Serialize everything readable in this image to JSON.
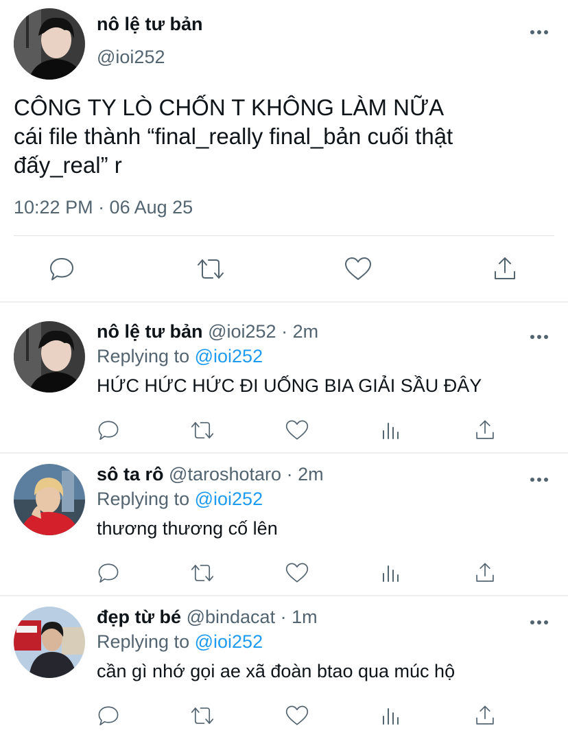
{
  "main_tweet": {
    "name": "nô lệ tư bản",
    "handle": "@ioi252",
    "text_lines": [
      "CÔNG TY LÒ CHỐN T KHÔNG LÀM NỮA",
      "cái file thành “final_really final_bản cuối thật",
      "đấy_real” r"
    ],
    "timestamp": "10:22 PM · 06 Aug 25",
    "actions": [
      "reply-icon",
      "retweet-icon",
      "like-icon",
      "share-icon"
    ]
  },
  "replies": [
    {
      "name": "nô lệ tư bản",
      "handle": "@ioi252",
      "separator": "·",
      "time": "2m",
      "replying_prefix": "Replying to",
      "replying_to": "@ioi252",
      "text": "HỨC HỨC HỨC ĐI UỐNG BIA GIẢI SẦU ĐÂY",
      "avatar_colors": {
        "bg": "#3a3a3a",
        "hair": "#111111",
        "skin": "#e9d2c4",
        "shirt": "#0c0c0c"
      }
    },
    {
      "name": "sô ta rô",
      "handle": "@taroshotaro",
      "separator": "·",
      "time": "2m",
      "replying_prefix": "Replying to",
      "replying_to": "@ioi252",
      "text": "thương thương cố lên",
      "avatar_colors": {
        "bg": "#5c7fa0",
        "hair": "#e8c98a",
        "skin": "#e8c7a8",
        "shirt": "#d4202a"
      }
    },
    {
      "name": "đẹp từ bé",
      "handle": "@bindacat",
      "separator": "·",
      "time": "1m",
      "replying_prefix": "Replying to",
      "replying_to": "@ioi252",
      "text": "cần gì nhớ gọi ae xã đoàn btao qua múc hộ",
      "avatar_colors": {
        "bg": "#b9cde3",
        "hair": "#1a1a1a",
        "skin": "#d9b59a",
        "shirt": "#26262e"
      }
    }
  ],
  "reply_actions": [
    "reply-icon",
    "retweet-icon",
    "like-icon",
    "views-icon",
    "share-icon"
  ],
  "colors": {
    "text": "#0f1419",
    "muted": "#536471",
    "link": "#1d9bf0",
    "divider": "#eceef0"
  }
}
